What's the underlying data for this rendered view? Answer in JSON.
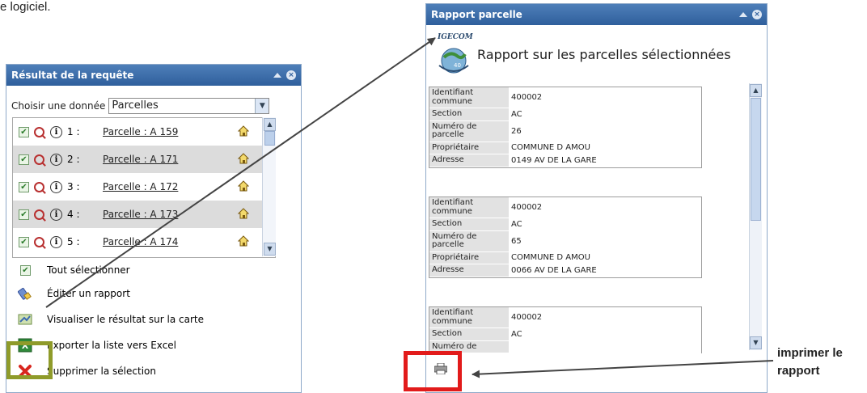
{
  "top_fragment": "e logiciel.",
  "left_panel": {
    "title": "Résultat de la requête",
    "choose_label": "Choisir une donnée",
    "choose_value": "Parcelles",
    "rows": [
      {
        "num": "1 :",
        "label": "Parcelle : A 159"
      },
      {
        "num": "2 :",
        "label": "Parcelle : A 171"
      },
      {
        "num": "3 :",
        "label": "Parcelle : A 172"
      },
      {
        "num": "4 :",
        "label": "Parcelle : A 173"
      },
      {
        "num": "5 :",
        "label": "Parcelle : A 174"
      }
    ],
    "actions": {
      "select_all": "Tout sélectionner",
      "edit_report": "Éditer un rapport",
      "view_map": "Visualiser le résultat sur la carte",
      "export_excel": "Exporter la liste vers Excel",
      "delete_selection": "Supprimer la sélection"
    }
  },
  "right_panel": {
    "title": "Rapport parcelle",
    "logo_text": "IGECOM",
    "logo_sub": "40",
    "report_title": "Rapport sur les parcelles sélectionnées",
    "labels": {
      "commune": "Identifiant commune",
      "section": "Section",
      "numero": "Numéro de parcelle",
      "proprietaire": "Propriétaire",
      "adresse": "Adresse"
    },
    "records": [
      {
        "commune": "400002",
        "section": "AC",
        "numero": "26",
        "proprietaire": "COMMUNE D AMOU",
        "adresse": "0149 AV DE LA GARE"
      },
      {
        "commune": "400002",
        "section": "AC",
        "numero": "65",
        "proprietaire": "COMMUNE D AMOU",
        "adresse": "0066 AV DE LA GARE"
      },
      {
        "commune": "400002",
        "section": "AC",
        "numero_partial": "Numéro de"
      }
    ]
  },
  "callout": {
    "line1": "imprimer le",
    "line2": "rapport"
  },
  "colors": {
    "titlebar": "#2f5f9c",
    "highlight_box": "#8f9b2a",
    "print_box": "#e21b1b"
  }
}
